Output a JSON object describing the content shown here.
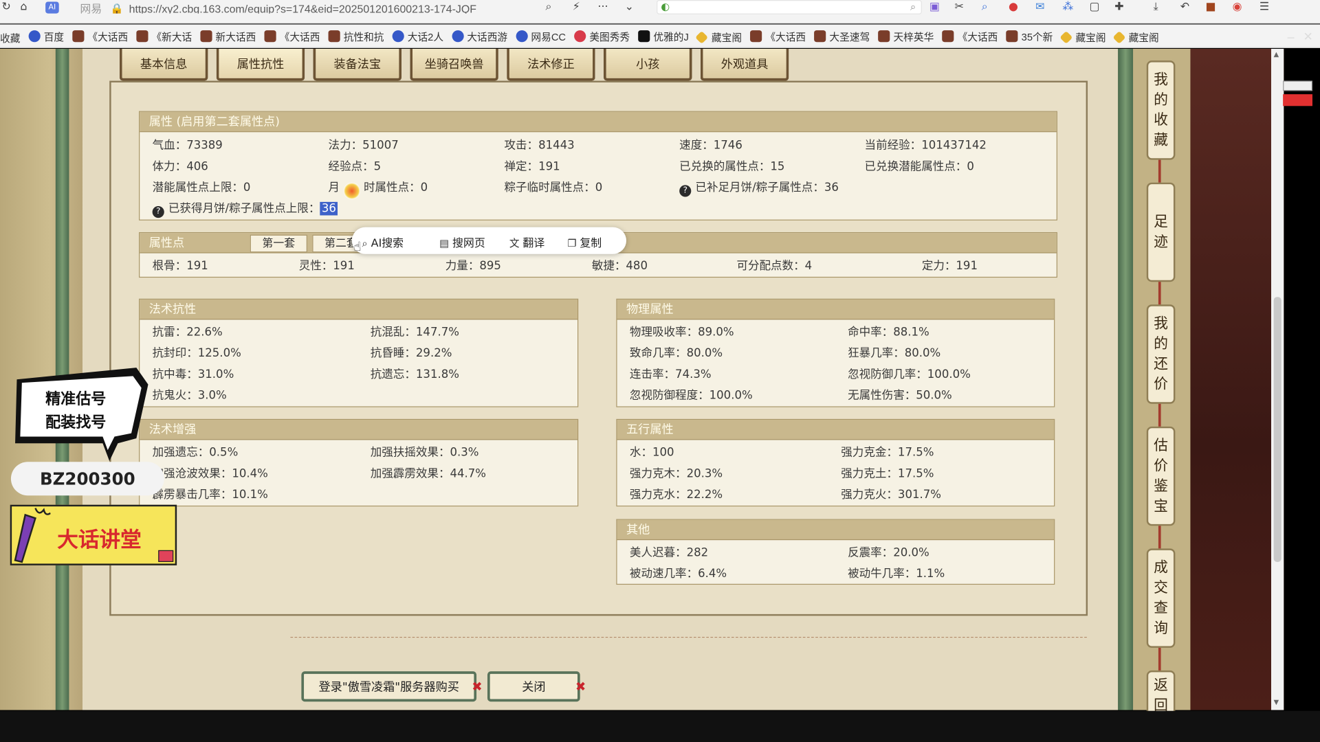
{
  "browser": {
    "site_label": "网易",
    "url": "https://xy2.cbg.163.com/equip?s=174&eid=202501201600213-174-JQF"
  },
  "bookmarks": [
    {
      "label": "收藏",
      "icon": "folder"
    },
    {
      "label": "百度",
      "icon": "baidu"
    },
    {
      "label": "《大话西",
      "icon": "game"
    },
    {
      "label": "《新大话",
      "icon": "game"
    },
    {
      "label": "新大话西",
      "icon": "game"
    },
    {
      "label": "《大话西",
      "icon": "game"
    },
    {
      "label": "抗性和抗",
      "icon": "game"
    },
    {
      "label": "大话2人",
      "icon": "wing"
    },
    {
      "label": "大话西游",
      "icon": "wing"
    },
    {
      "label": "网易CC",
      "icon": "cc"
    },
    {
      "label": "美图秀秀",
      "icon": "meitu"
    },
    {
      "label": "优雅的J",
      "icon": "tiktok"
    },
    {
      "label": "藏宝阁",
      "icon": "treasure"
    },
    {
      "label": "《大话西",
      "icon": "game"
    },
    {
      "label": "大圣速驾",
      "icon": "game"
    },
    {
      "label": "天梓英华",
      "icon": "game"
    },
    {
      "label": "《大话西",
      "icon": "game"
    },
    {
      "label": "35个新",
      "icon": "game"
    },
    {
      "label": "藏宝阁",
      "icon": "treasure"
    },
    {
      "label": "藏宝阁",
      "icon": "treasure"
    }
  ],
  "tabs": [
    "基本信息",
    "属性抗性",
    "装备法宝",
    "坐骑召唤兽",
    "法术修正",
    "小孩",
    "外观道具"
  ],
  "attr": {
    "header": "属性 (启用第二套属性点)",
    "row1": [
      "气血：73389",
      "法力：51007",
      "攻击：81443",
      "速度：1746",
      "当前经验：101437142"
    ],
    "row2": [
      "体力：406",
      "经验点：5",
      "禅定：191",
      "已兑换的属性点：15",
      "已兑换潜能属性点：0"
    ],
    "row3": [
      "潜能属性点上限：0",
      "月",
      "时属性点：0",
      "粽子临时属性点：0",
      "已补足月饼/粽子属性点：36"
    ],
    "row4_label": "已获得月饼/粽子属性点上限：",
    "row4_value": "36"
  },
  "points": {
    "header": "属性点",
    "sub_tabs": [
      "第一套",
      "第二套"
    ],
    "values": [
      "根骨：191",
      "灵性：191",
      "力量：895",
      "敏捷：480",
      "可分配点数：4",
      "定力：191"
    ]
  },
  "context_menu": [
    "AI搜索",
    "搜网页",
    "翻译",
    "复制"
  ],
  "resist": {
    "header": "法术抗性",
    "left": [
      "抗雷：22.6%",
      "抗封印：125.0%",
      "抗中毒：31.0%",
      "抗鬼火：3.0%"
    ],
    "right": [
      "抗混乱：147.7%",
      "抗昏睡：29.2%",
      "抗遗忘：131.8%"
    ]
  },
  "enhance": {
    "header": "法术增强",
    "left": [
      "加强遗忘：0.5%",
      "加强沧波效果：10.4%",
      "霹雳暴击几率：10.1%"
    ],
    "right": [
      "加强扶摇效果：0.3%",
      "加强霹雳效果：44.7%"
    ]
  },
  "phys": {
    "header": "物理属性",
    "left": [
      "物理吸收率：89.0%",
      "致命几率：80.0%",
      "连击率：74.3%",
      "忽视防御程度：100.0%"
    ],
    "right": [
      "命中率：88.1%",
      "狂暴几率：80.0%",
      "忽视防御几率：100.0%",
      "无属性伤害：50.0%"
    ]
  },
  "five": {
    "header": "五行属性",
    "left": [
      "水：100",
      "强力克木：20.3%",
      "强力克水：22.2%"
    ],
    "right": [
      "强力克金：17.5%",
      "强力克土：17.5%",
      "强力克火：301.7%"
    ]
  },
  "other": {
    "header": "其他",
    "left": [
      "美人迟暮：282",
      "被动速几率：6.4%"
    ],
    "right": [
      "反震率：20.0%",
      "被动牛几率：1.1%"
    ]
  },
  "side_buttons": [
    "我的收藏",
    "足迹",
    "我的还价",
    "估价鉴宝",
    "成交查询",
    "返回"
  ],
  "overlay": {
    "bubble_line1": "精准估号",
    "bubble_line2": "配装找号",
    "code": "BZ200300",
    "banner": "大话讲堂"
  },
  "bottom_buttons": {
    "login": "登录\"傲雪凌霜\"服务器购买",
    "close": "关闭"
  },
  "colors": {
    "panel_header": "#c9b88d",
    "highlight": "#3e62c9",
    "pillar_green": "#6a8c66",
    "banner_yellow": "#f6e55a",
    "banner_text": "#d8282e"
  }
}
